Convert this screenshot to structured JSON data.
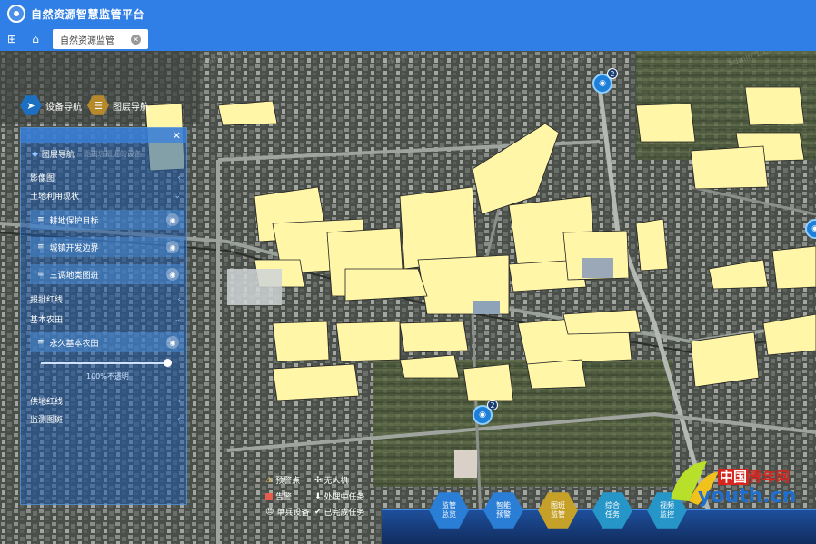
{
  "header": {
    "title": "自然资源智慧监管平台"
  },
  "tabs": {
    "active_label": "自然资源监管"
  },
  "topnav": {
    "device_nav": "设备导航",
    "layer_nav": "图层导航"
  },
  "panel": {
    "title": "图层导航",
    "subtitle": "距离您最近的设备",
    "sections": [
      {
        "label": "影像图"
      },
      {
        "label": "土地利用现状"
      },
      {
        "label": "耕地保护目标"
      },
      {
        "label": "城镇开发边界"
      },
      {
        "label": "三调地类图斑"
      },
      {
        "label": "报批红线"
      },
      {
        "label": "基本农田"
      },
      {
        "label": "永久基本农田"
      },
      {
        "label": "供地红线"
      },
      {
        "label": "监测图斑"
      }
    ],
    "opacity_label": "100%不透明"
  },
  "stats": {
    "warn": "预警点",
    "drone": "无人机",
    "alarm": "告警",
    "tasks_processing": "处理中任务",
    "single_device": "单兵设备",
    "tasks_done": "已完成任务"
  },
  "bottom_buttons": [
    {
      "line1": "监管",
      "line2": "总览"
    },
    {
      "line1": "智能",
      "line2": "预警"
    },
    {
      "line1": "图斑",
      "line2": "监管"
    },
    {
      "line1": "综合",
      "line2": "任务"
    },
    {
      "line1": "视频",
      "line2": "监控"
    }
  ],
  "markers": [
    {
      "count": "2"
    },
    {
      "count": "2"
    }
  ],
  "brand": {
    "cn_part": "中国",
    "name_part": "青年网",
    "domain": "youth.cn"
  },
  "watermark": {
    "user": "admin",
    "ip": "10.70.220"
  },
  "colors": {
    "accent": "#2f7fe6",
    "parcel": "#fff6a8",
    "gold": "#c6a12a"
  }
}
